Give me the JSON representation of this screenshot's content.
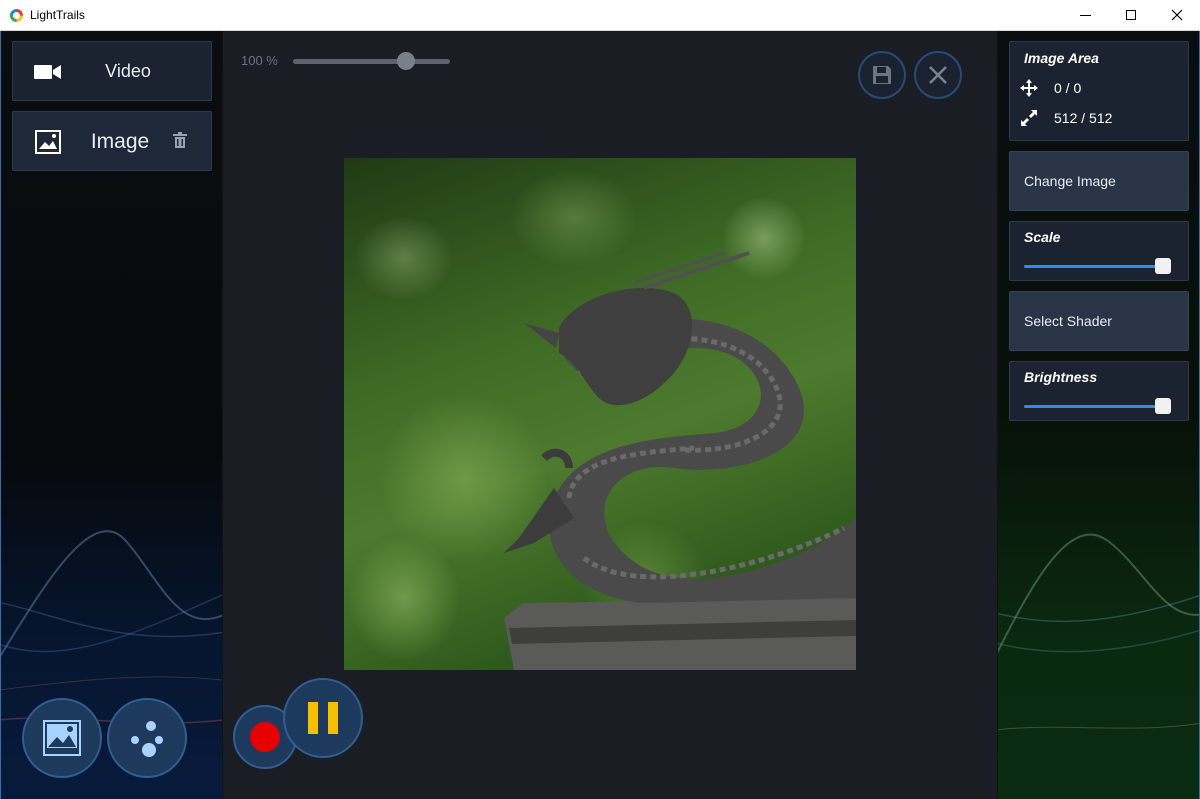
{
  "window": {
    "title": "LightTrails"
  },
  "sidebar": {
    "items": [
      {
        "label": "Video",
        "icon": "video-camera-icon"
      },
      {
        "label": "Image",
        "icon": "image-icon"
      }
    ]
  },
  "toolbar": {
    "zoom_label": "100 %",
    "zoom_value_percent": 100
  },
  "properties": {
    "image_area": {
      "title": "Image Area",
      "position": "0 / 0",
      "size": "512 / 512"
    },
    "change_image_label": "Change Image",
    "scale": {
      "title": "Scale",
      "value_fraction": 1.0
    },
    "select_shader_label": "Select Shader",
    "brightness": {
      "title": "Brightness",
      "value_fraction": 1.0
    }
  },
  "colors": {
    "accent_blue": "#2d8ee8",
    "record_red": "#e60000",
    "pause_yellow": "#f5c000",
    "panel_bg": "#1a1d23"
  }
}
